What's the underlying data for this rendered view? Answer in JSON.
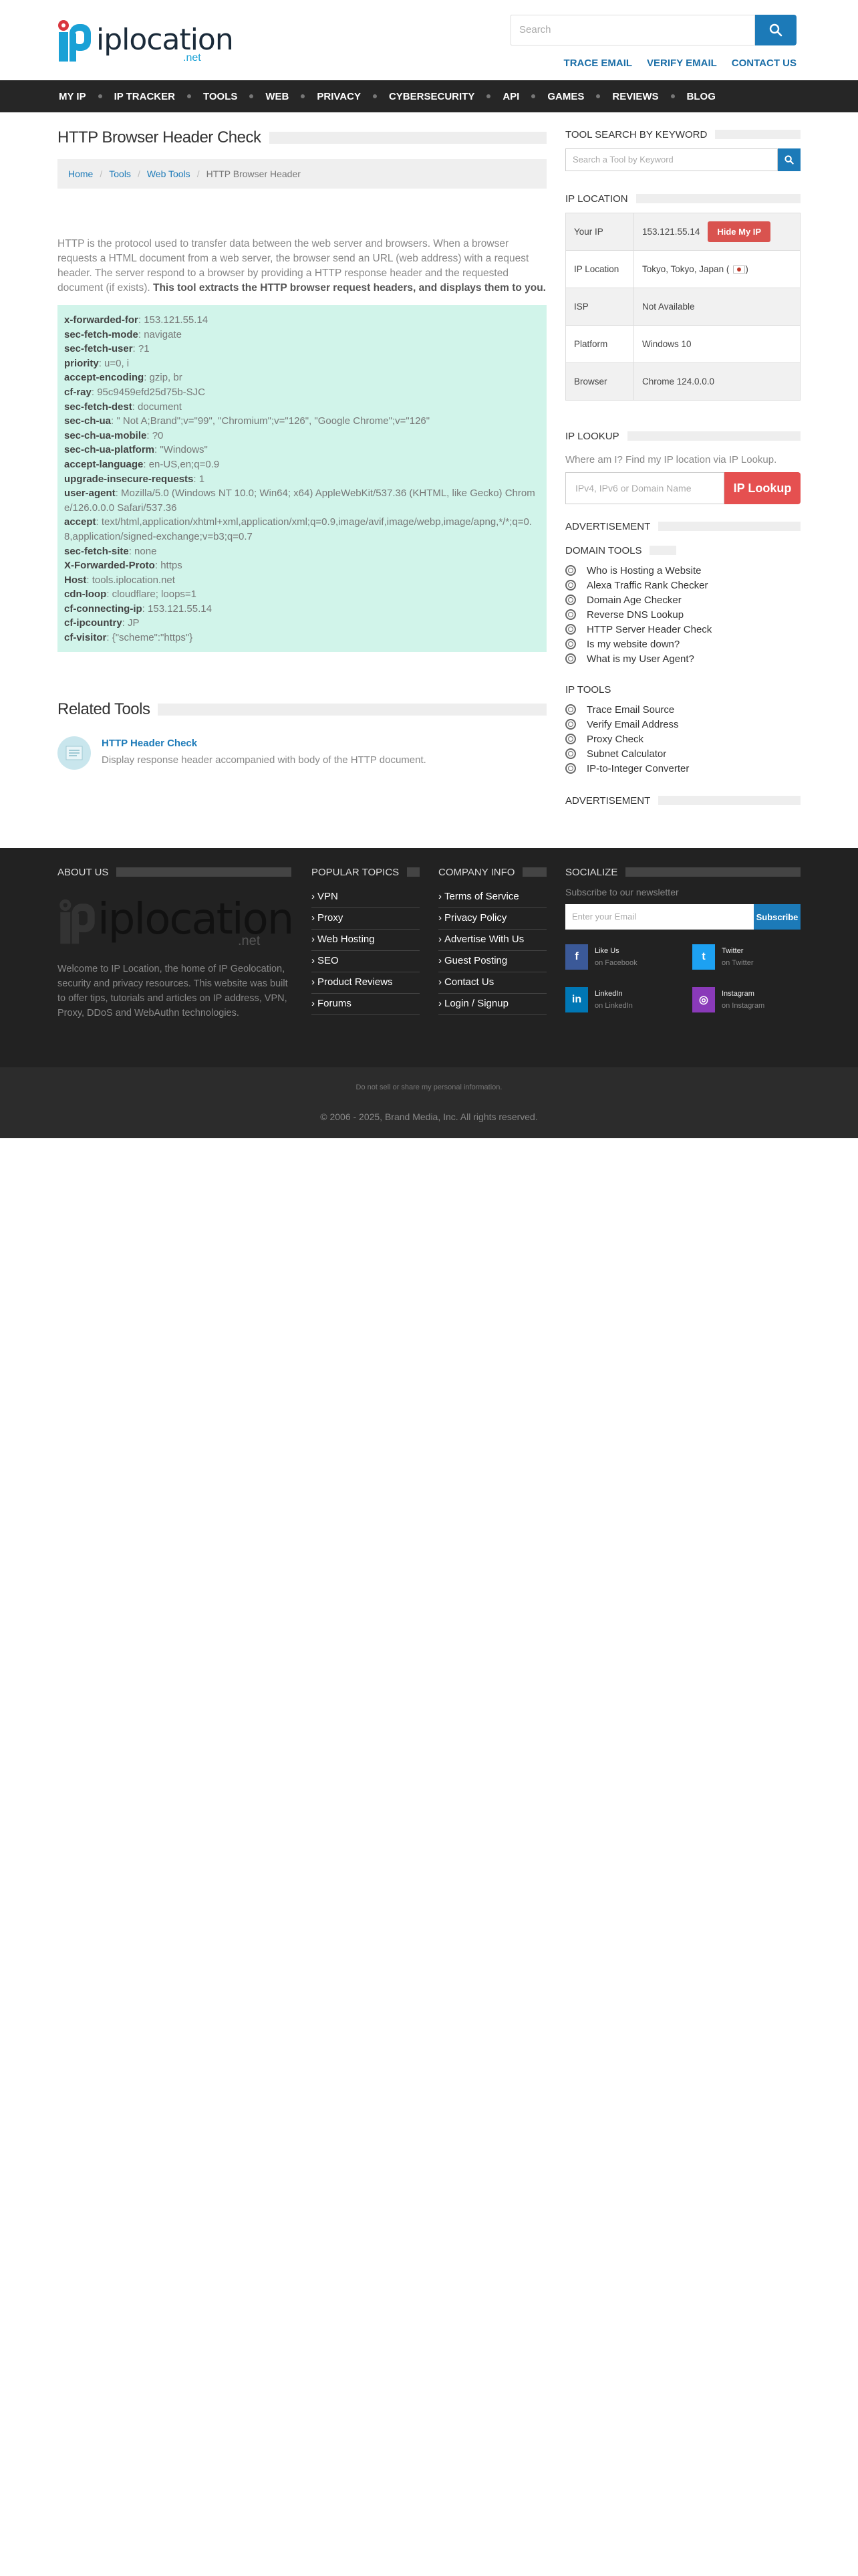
{
  "brand": {
    "logo_main": "iplocation",
    "logo_suffix": ".net"
  },
  "header": {
    "search_placeholder": "Search",
    "top_links": [
      "TRACE EMAIL",
      "VERIFY EMAIL",
      "CONTACT US"
    ]
  },
  "nav": [
    "MY IP",
    "IP TRACKER",
    "TOOLS",
    "WEB",
    "PRIVACY",
    "CYBERSECURITY",
    "API",
    "GAMES",
    "REVIEWS",
    "BLOG"
  ],
  "page": {
    "title": "HTTP Browser Header Check",
    "breadcrumb": [
      "Home",
      "Tools",
      "Web Tools",
      "HTTP Browser Header"
    ],
    "intro": "HTTP is the protocol used to transfer data between the web server and browsers. When a browser requests a HTML document from a web server, the browser send an URL (web address) with a request header. The server respond to a browser by providing a HTTP response header and the requested document (if exists).",
    "intro_bold": "This tool extracts the HTTP browser request headers, and displays them to you."
  },
  "headers": [
    {
      "k": "x-forwarded-for",
      "v": "153.121.55.14"
    },
    {
      "k": "sec-fetch-mode",
      "v": "navigate"
    },
    {
      "k": "sec-fetch-user",
      "v": "?1"
    },
    {
      "k": "priority",
      "v": "u=0, i"
    },
    {
      "k": "accept-encoding",
      "v": "gzip, br"
    },
    {
      "k": "cf-ray",
      "v": "95c9459efd25d75b-SJC"
    },
    {
      "k": "sec-fetch-dest",
      "v": "document"
    },
    {
      "k": "sec-ch-ua",
      "v": "\" Not A;Brand\";v=\"99\", \"Chromium\";v=\"126\", \"Google Chrome\";v=\"126\""
    },
    {
      "k": "sec-ch-ua-mobile",
      "v": "?0"
    },
    {
      "k": "sec-ch-ua-platform",
      "v": "\"Windows\""
    },
    {
      "k": "accept-language",
      "v": "en-US,en;q=0.9"
    },
    {
      "k": "upgrade-insecure-requests",
      "v": "1"
    },
    {
      "k": "user-agent",
      "v": "Mozilla/5.0 (Windows NT 10.0; Win64; x64) AppleWebKit/537.36 (KHTML, like Gecko) Chrome/126.0.0.0 Safari/537.36"
    },
    {
      "k": "accept",
      "v": "text/html,application/xhtml+xml,application/xml;q=0.9,image/avif,image/webp,image/apng,*/*;q=0.8,application/signed-exchange;v=b3;q=0.7"
    },
    {
      "k": "sec-fetch-site",
      "v": "none"
    },
    {
      "k": "X-Forwarded-Proto",
      "v": "https"
    },
    {
      "k": "Host",
      "v": "tools.iplocation.net"
    },
    {
      "k": "cdn-loop",
      "v": "cloudflare; loops=1"
    },
    {
      "k": "cf-connecting-ip",
      "v": "153.121.55.14"
    },
    {
      "k": "cf-ipcountry",
      "v": "JP"
    },
    {
      "k": "cf-visitor",
      "v": "{\"scheme\":\"https\"}"
    }
  ],
  "related": {
    "title": "Related Tools",
    "items": [
      {
        "title": "HTTP Header Check",
        "desc": "Display response header accompanied with body of the HTTP document."
      }
    ]
  },
  "sidebar": {
    "tool_search": {
      "title": "TOOL SEARCH BY KEYWORD",
      "placeholder": "Search a Tool by Keyword"
    },
    "ip_location": {
      "title": "IP LOCATION",
      "rows": [
        {
          "label": "Your IP",
          "value": "153.121.55.14"
        },
        {
          "label": "IP Location",
          "value": "Tokyo, Tokyo, Japan ("
        },
        {
          "label": "ISP",
          "value": "Not Available"
        },
        {
          "label": "Platform",
          "value": "Windows 10"
        },
        {
          "label": "Browser",
          "value": "Chrome 124.0.0.0"
        }
      ],
      "hide_label": "Hide My IP",
      "location_suffix": ")"
    },
    "ip_lookup": {
      "title": "IP LOOKUP",
      "text": "Where am I? Find my IP location via IP Lookup.",
      "placeholder": "IPv4, IPv6 or Domain Name",
      "button": "IP Lookup"
    },
    "advertisement": "ADVERTISEMENT",
    "domain_tools": {
      "title": "DOMAIN TOOLS",
      "items": [
        "Who is Hosting a Website",
        "Alexa Traffic Rank Checker",
        "Domain Age Checker",
        "Reverse DNS Lookup",
        "HTTP Server Header Check",
        "Is my website down?",
        "What is my User Agent?"
      ]
    },
    "ip_tools": {
      "title": "IP TOOLS",
      "items": [
        "Trace Email Source",
        "Verify Email Address",
        "Proxy Check",
        "Subnet Calculator",
        "IP-to-Integer Converter"
      ]
    }
  },
  "footer": {
    "about": {
      "title": "ABOUT US",
      "text": "Welcome to IP Location, the home of IP Geolocation, security and privacy resources. This website was built to offer tips, tutorials and articles on IP address, VPN, Proxy, DDoS and WebAuthn technologies."
    },
    "popular": {
      "title": "POPULAR TOPICS",
      "items": [
        "VPN",
        "Proxy",
        "Web Hosting",
        "SEO",
        "Product Reviews",
        "Forums"
      ]
    },
    "company": {
      "title": "COMPANY INFO",
      "items": [
        "Terms of Service",
        "Privacy Policy",
        "Advertise With Us",
        "Guest Posting",
        "Contact Us",
        "Login / Signup"
      ]
    },
    "socialize": {
      "title": "SOCIALIZE",
      "newsletter": "Subscribe to our newsletter",
      "placeholder": "Enter your Email",
      "button": "Subscribe",
      "items": [
        {
          "name": "Like Us",
          "sub": "on Facebook",
          "color": "#3b5998",
          "glyph": "f"
        },
        {
          "name": "Twitter",
          "sub": "on Twitter",
          "color": "#1da1f2",
          "glyph": "t"
        },
        {
          "name": "LinkedIn",
          "sub": "on LinkedIn",
          "color": "#0077b5",
          "glyph": "in"
        },
        {
          "name": "Instagram",
          "sub": "on Instagram",
          "color": "#8a3ab9",
          "glyph": "◎"
        }
      ]
    },
    "do_not_sell": "Do not sell or share my personal information.",
    "copyright": "© 2006 - 2025, Brand Media, Inc. All rights reserved."
  },
  "colors": {
    "accent": "#1c7ab8",
    "nav_bg": "#262626",
    "header_box_bg": "#d1f4ea",
    "danger": "#e55050"
  }
}
